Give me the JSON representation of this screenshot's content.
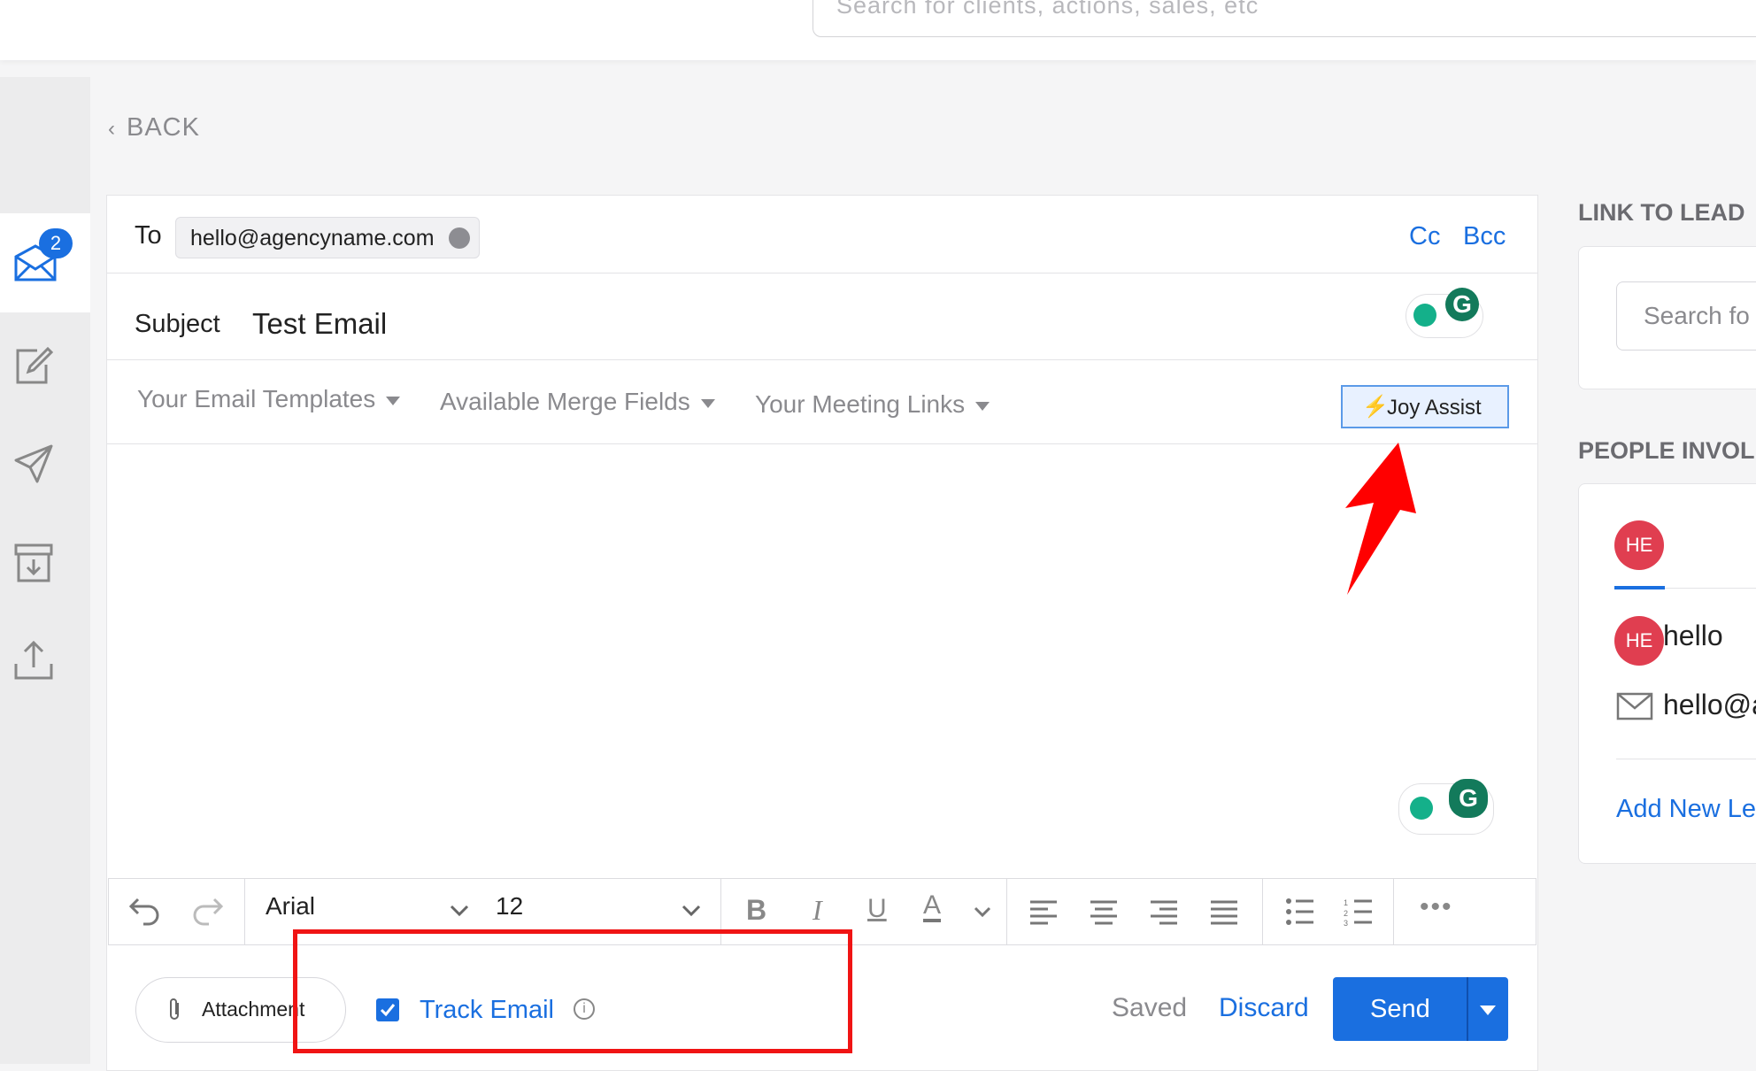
{
  "header": {
    "search_placeholder": "Search for clients, actions, sales, etc"
  },
  "sidebar": {
    "items": [
      {
        "icon": "inbox-icon",
        "badge": "2",
        "active": true
      },
      {
        "icon": "compose-icon"
      },
      {
        "icon": "sent-icon"
      },
      {
        "icon": "archive-icon"
      },
      {
        "icon": "upload-icon"
      }
    ]
  },
  "nav": {
    "back_label": "BACK"
  },
  "compose": {
    "to_label": "To",
    "to_chip": "hello@agencyname.com",
    "cc_label": "Cc",
    "bcc_label": "Bcc",
    "subject_label": "Subject",
    "subject_value": "Test Email",
    "templates_label": "Your Email Templates",
    "merge_fields_label": "Available Merge Fields",
    "meeting_links_label": "Your Meeting Links",
    "joy_assist_label": "Joy Assist",
    "toolbar": {
      "font_family": "Arial",
      "font_size": "12"
    },
    "attachment_label": "Attachment",
    "track_email_label": "Track Email",
    "track_email_checked": true,
    "saved_label": "Saved",
    "discard_label": "Discard",
    "send_label": "Send"
  },
  "right_panel": {
    "link_heading": "LINK TO LEAD",
    "search_placeholder": "Search fo",
    "people_heading": "PEOPLE INVOL",
    "avatar_initials": "HE",
    "person_name": "hello",
    "person_email": "hello@a",
    "add_new_label": "Add New Le"
  },
  "colors": {
    "accent": "#1a6fe0",
    "highlight": "#f01414",
    "avatar": "#e03e50"
  }
}
